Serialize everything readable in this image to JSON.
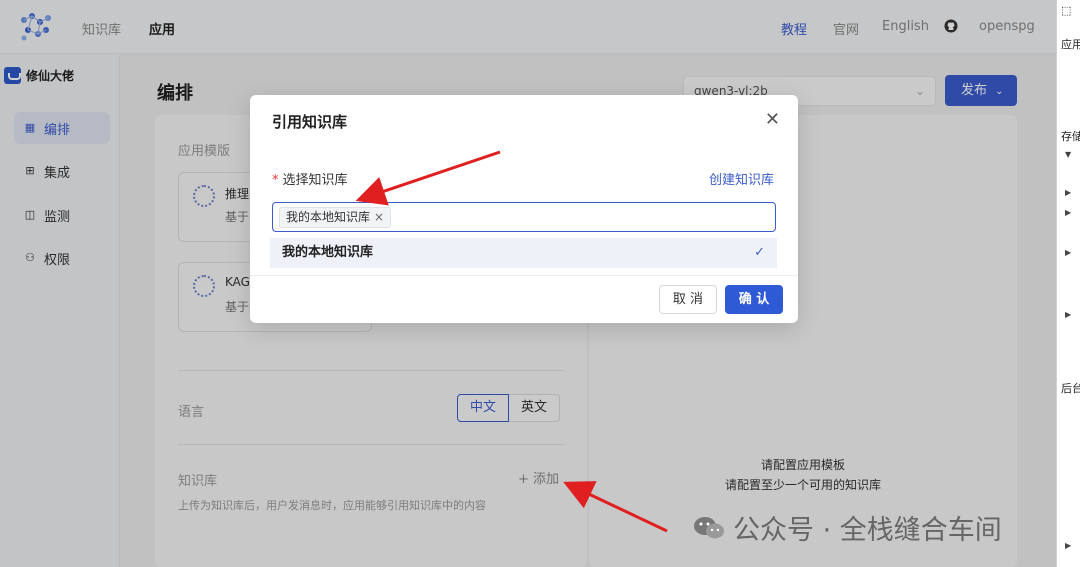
{
  "header": {
    "nav": {
      "kb": "知识库",
      "app": "应用"
    },
    "links": {
      "tutorial": "教程",
      "official": "官网",
      "english": "English",
      "openspg": "openspg"
    }
  },
  "sidebar": {
    "app_name": "修仙大佬",
    "items": [
      {
        "label": "编排",
        "icon": "layout-icon",
        "active": true
      },
      {
        "label": "集成",
        "icon": "grid-icon",
        "active": false
      },
      {
        "label": "监测",
        "icon": "monitor-icon",
        "active": false
      },
      {
        "label": "权限",
        "icon": "people-icon",
        "active": false
      }
    ]
  },
  "main": {
    "title": "编排",
    "model": "qwen3-vl:2b",
    "publish": "发布",
    "template_label": "应用模版",
    "templates": [
      {
        "name": "推理",
        "desc": "基于"
      },
      {
        "name": "KAG",
        "desc": "基于"
      }
    ],
    "language_label": "语言",
    "languages": [
      "中文",
      "英文"
    ],
    "kb_label": "知识库",
    "kb_add": "+ 添加",
    "kb_hint": "上传为知识库后，用户发消息时，应用能够引用知识库中的内容",
    "empty_line1": "请配置应用模板",
    "empty_line2": "请配置至少一个可用的知识库"
  },
  "modal": {
    "title": "引用知识库",
    "field_label": "选择知识库",
    "create_link": "创建知识库",
    "selected_tag": "我的本地知识库",
    "option": "我的本地知识库",
    "cancel": "取 消",
    "confirm": "确 认"
  },
  "devtools": {
    "t1": "应用",
    "t2": "存储",
    "t3": "后台"
  },
  "watermark": "公众号 · 全栈缝合车间",
  "colors": {
    "primary": "#3b5ccc",
    "annotation_arrow": "#e02020"
  }
}
